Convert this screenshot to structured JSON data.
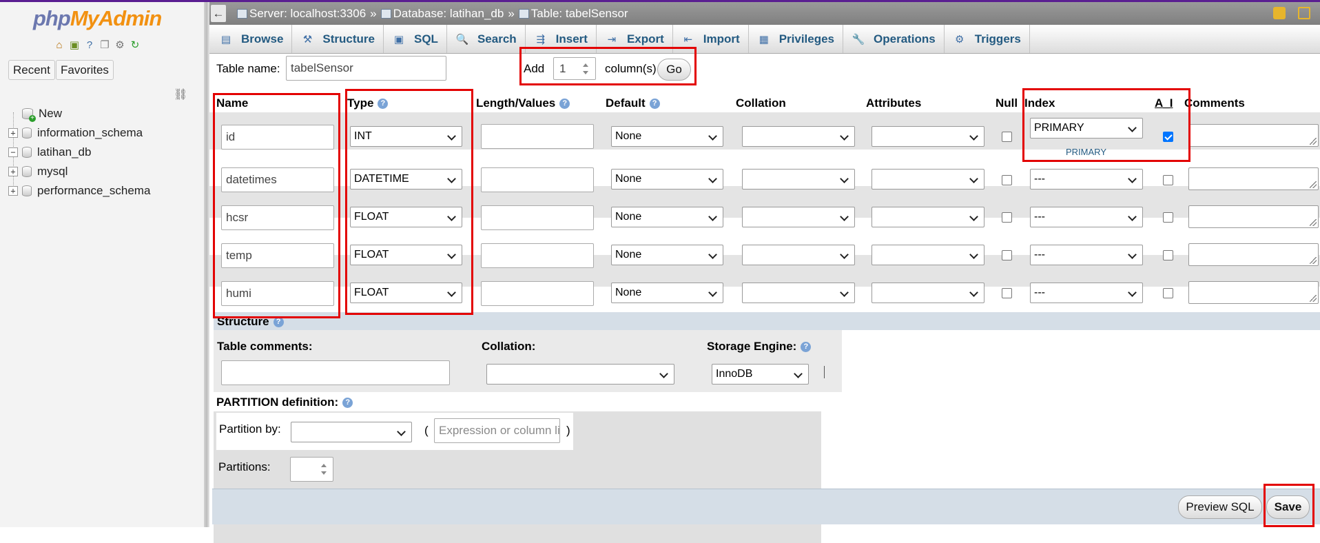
{
  "app": {
    "logo_php": "php",
    "logo_myadmin": "MyAdmin",
    "nav_icons": [
      "home-icon",
      "logout-icon",
      "help-icon",
      "docs-icon",
      "settings-icon",
      "reload-icon"
    ]
  },
  "nav": {
    "recent": "Recent",
    "favorites": "Favorites",
    "tree": [
      {
        "label": "New",
        "type": "new"
      },
      {
        "label": "information_schema",
        "exp": "+"
      },
      {
        "label": "latihan_db",
        "exp": "−"
      },
      {
        "label": "mysql",
        "exp": "+"
      },
      {
        "label": "performance_schema",
        "exp": "+"
      }
    ]
  },
  "breadcrumb": {
    "server": "Server: localhost:3306",
    "sep1": "»",
    "database": "Database: latihan_db",
    "sep2": "»",
    "table": "Table: tabelSensor"
  },
  "tabs": [
    {
      "label": "Browse",
      "icon": "▤"
    },
    {
      "label": "Structure",
      "icon": "⚒"
    },
    {
      "label": "SQL",
      "icon": "▣"
    },
    {
      "label": "Search",
      "icon": "🔍"
    },
    {
      "label": "Insert",
      "icon": "⇶"
    },
    {
      "label": "Export",
      "icon": "⇥"
    },
    {
      "label": "Import",
      "icon": "⇤"
    },
    {
      "label": "Privileges",
      "icon": "▦"
    },
    {
      "label": "Operations",
      "icon": "🔧"
    },
    {
      "label": "Triggers",
      "icon": "⚙"
    }
  ],
  "form": {
    "table_name_label": "Table name:",
    "table_name": "tabelSensor",
    "add_label": "Add",
    "add_count": "1",
    "columns_label": "column(s)",
    "go_label": "Go"
  },
  "headers": {
    "name": "Name",
    "type": "Type",
    "length": "Length/Values",
    "default": "Default",
    "collation": "Collation",
    "attributes": "Attributes",
    "null": "Null",
    "index": "Index",
    "ai": "A_I",
    "comments": "Comments"
  },
  "columns": [
    {
      "name": "id",
      "type": "INT",
      "default": "None",
      "index": "PRIMARY",
      "index_note": "PRIMARY",
      "ai": true
    },
    {
      "name": "datetimes",
      "type": "DATETIME",
      "default": "None",
      "index": "---",
      "ai": false
    },
    {
      "name": "hcsr",
      "type": "FLOAT",
      "default": "None",
      "index": "---",
      "ai": false
    },
    {
      "name": "temp",
      "type": "FLOAT",
      "default": "None",
      "index": "---",
      "ai": false
    },
    {
      "name": "humi",
      "type": "FLOAT",
      "default": "None",
      "index": "---",
      "ai": false
    }
  ],
  "structure": {
    "title": "Structure",
    "table_comments_label": "Table comments:",
    "collation_label": "Collation:",
    "engine_label": "Storage Engine:",
    "engine": "InnoDB"
  },
  "partition": {
    "title": "PARTITION definition:",
    "by_label": "Partition by:",
    "open_paren": "(",
    "close_paren": ")",
    "expr_placeholder": "Expression or column list",
    "partitions_label": "Partitions:"
  },
  "footer": {
    "preview_sql": "Preview SQL",
    "save": "Save"
  },
  "colors": {
    "highlight": "#e30000",
    "tab_text": "#235a81",
    "row_alt": "#e4e4e4"
  }
}
